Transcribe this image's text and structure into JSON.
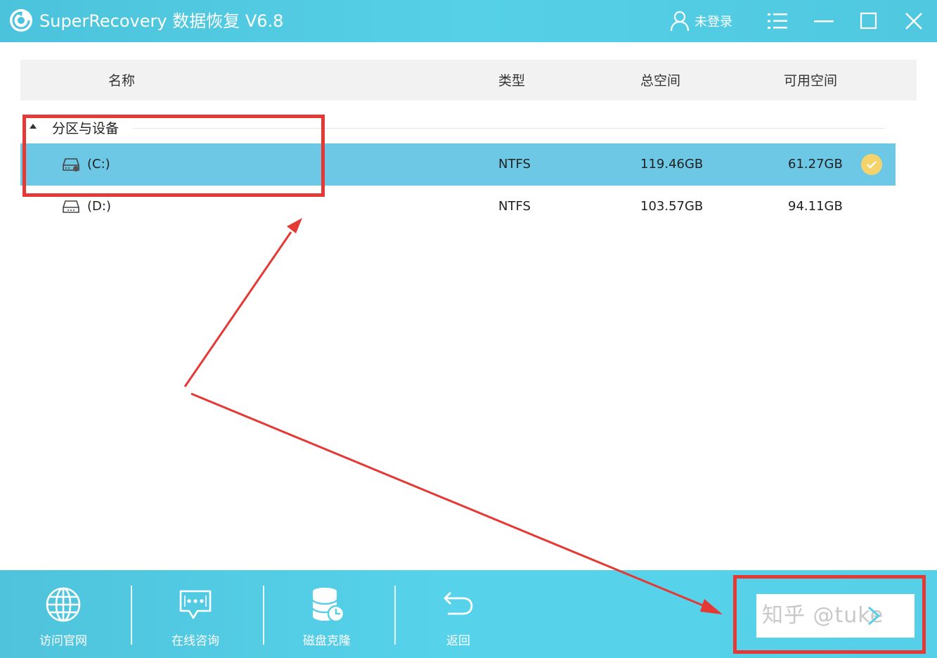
{
  "window": {
    "title": "SuperRecovery 数据恢复 V6.8",
    "user_label": "未登录",
    "menu_icon": "list-menu-icon",
    "minimize_icon": "minimize-icon",
    "maximize_icon": "maximize-icon",
    "close_icon": "close-icon",
    "accent_color": "#55d0e6"
  },
  "table": {
    "headers": {
      "name": "名称",
      "type": "类型",
      "total": "总空间",
      "free": "可用空间"
    },
    "group": {
      "label": "分区与设备"
    },
    "rows": [
      {
        "name": "(C:)",
        "type": "NTFS",
        "total": "119.46GB",
        "free": "61.27GB",
        "selected": true
      },
      {
        "name": "(D:)",
        "type": "NTFS",
        "total": "103.57GB",
        "free": "94.11GB",
        "selected": false
      }
    ],
    "selected_color": "#6dc8e5",
    "check_color": "#f5d36b"
  },
  "bottom_bar": {
    "items": [
      {
        "label": "访问官网",
        "icon": "globe-icon"
      },
      {
        "label": "在线咨询",
        "icon": "chat-icon"
      },
      {
        "label": "磁盘克隆",
        "icon": "database-clone-icon"
      },
      {
        "label": "返回",
        "icon": "return-icon"
      }
    ],
    "next_icon": "chevron-right-icon",
    "watermark": "知乎 @tuke"
  },
  "annotations": {
    "color": "#e53935"
  }
}
